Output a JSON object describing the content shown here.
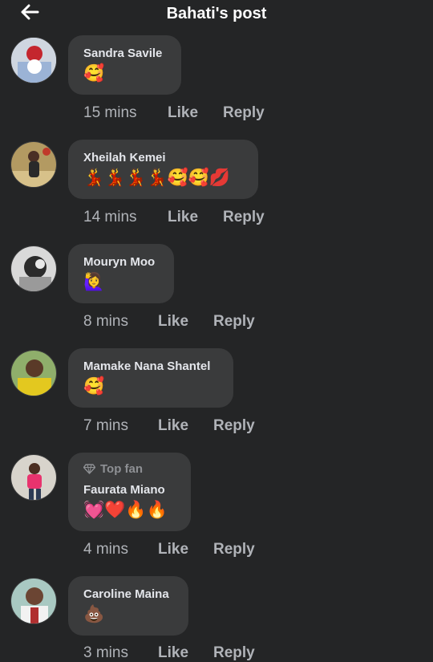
{
  "header": {
    "title": "Bahati's post",
    "back_icon": "arrow-left-icon"
  },
  "actions": {
    "like": "Like",
    "reply": "Reply"
  },
  "top_fan_label": "Top fan",
  "comments": [
    {
      "name": "Sandra Savile",
      "text": "🥰",
      "time": "15 mins",
      "top_fan": false
    },
    {
      "name": "Xheilah Kemei",
      "text": "💃💃💃💃🥰🥰💋",
      "time": "14 mins",
      "top_fan": false
    },
    {
      "name": "Mouryn Moo",
      "text": "🙋‍♀️",
      "time": "8 mins",
      "top_fan": false
    },
    {
      "name": "Mamake Nana Shantel",
      "text": "🥰",
      "time": "7 mins",
      "top_fan": false
    },
    {
      "name": "Faurata Miano",
      "text": "💓❤️🔥🔥",
      "time": "4 mins",
      "top_fan": true
    },
    {
      "name": "Caroline Maina",
      "text": "💩",
      "time": "3 mins",
      "top_fan": false
    }
  ],
  "colors": {
    "background": "#242526",
    "bubble": "#3a3b3c",
    "text": "#e4e6eb",
    "secondary": "#b0b3b8"
  }
}
